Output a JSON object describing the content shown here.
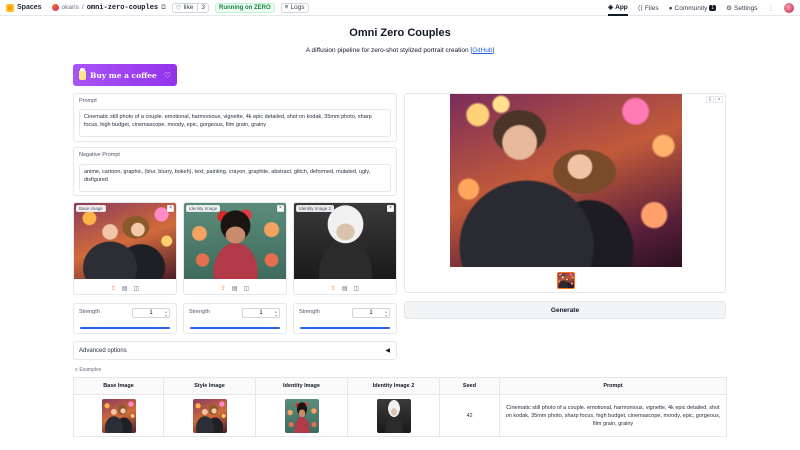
{
  "topbar": {
    "brand": "Spaces",
    "owner": "okaris",
    "repo": "omni-zero-couples",
    "like_label": "like",
    "like_count": "3",
    "status": "Running on ZERO",
    "logs": "Logs",
    "nav": [
      {
        "label": "App",
        "icon": "app-icon"
      },
      {
        "label": "Files",
        "icon": "files-icon"
      },
      {
        "label": "Community",
        "icon": "community-icon",
        "badge": "1"
      },
      {
        "label": "Settings",
        "icon": "gear-icon"
      }
    ]
  },
  "header": {
    "title": "Omni Zero Couples",
    "subtitle": "A diffusion pipeline for zero-shot stylized portrait creation",
    "link_open": "[",
    "link_text": "GitHub",
    "link_close": "]"
  },
  "coffee_button": {
    "label": "Buy me a coffee",
    "heart": "♡"
  },
  "prompt": {
    "label": "Prompt",
    "value": "Cinematic still photo of a couple. emotional, harmonious, vignette, 4k epic detailed, shot on kodak, 35mm photo, sharp focus, high budget, cinemascope, moody, epic, gorgeous, film grain, grainy"
  },
  "negative_prompt": {
    "label": "Negative Prompt",
    "value": "anime, cartoon, graphic, (blur, blurry, bokeh), text, painting, crayon, graphite, abstract, glitch, deformed, mutated, ugly, disfigured"
  },
  "images": [
    {
      "label": "Base image",
      "close": "×"
    },
    {
      "label": "Identity Image",
      "close": "×"
    },
    {
      "label": "Identity Image 2",
      "close": "×"
    }
  ],
  "strengths": [
    {
      "label": "Strength",
      "value": "1",
      "fraction": 1.0
    },
    {
      "label": "Strength",
      "value": "1",
      "fraction": 1.0
    },
    {
      "label": "Strength",
      "value": "1",
      "fraction": 1.0
    }
  ],
  "advanced": {
    "label": "Advanced options",
    "arrow": "◀"
  },
  "generate": {
    "label": "Generate"
  },
  "examples": {
    "label": "Examples",
    "columns": [
      "Base Image",
      "Style Image",
      "Identity Image",
      "Identity Image 2",
      "Seed",
      "Prompt"
    ],
    "row": {
      "seed": "42",
      "prompt": "Cinematic still photo of a couple. emotional, harmonious, vignette, 4k epic detailed, shot on kodak, 35mm photo, sharp focus, high budget, cinemascope, moody, epic, gorgeous, film grain, grainy"
    }
  },
  "colors": {
    "accent": "#2563eb",
    "coffee": "#9333ea",
    "running": "#15803d"
  }
}
